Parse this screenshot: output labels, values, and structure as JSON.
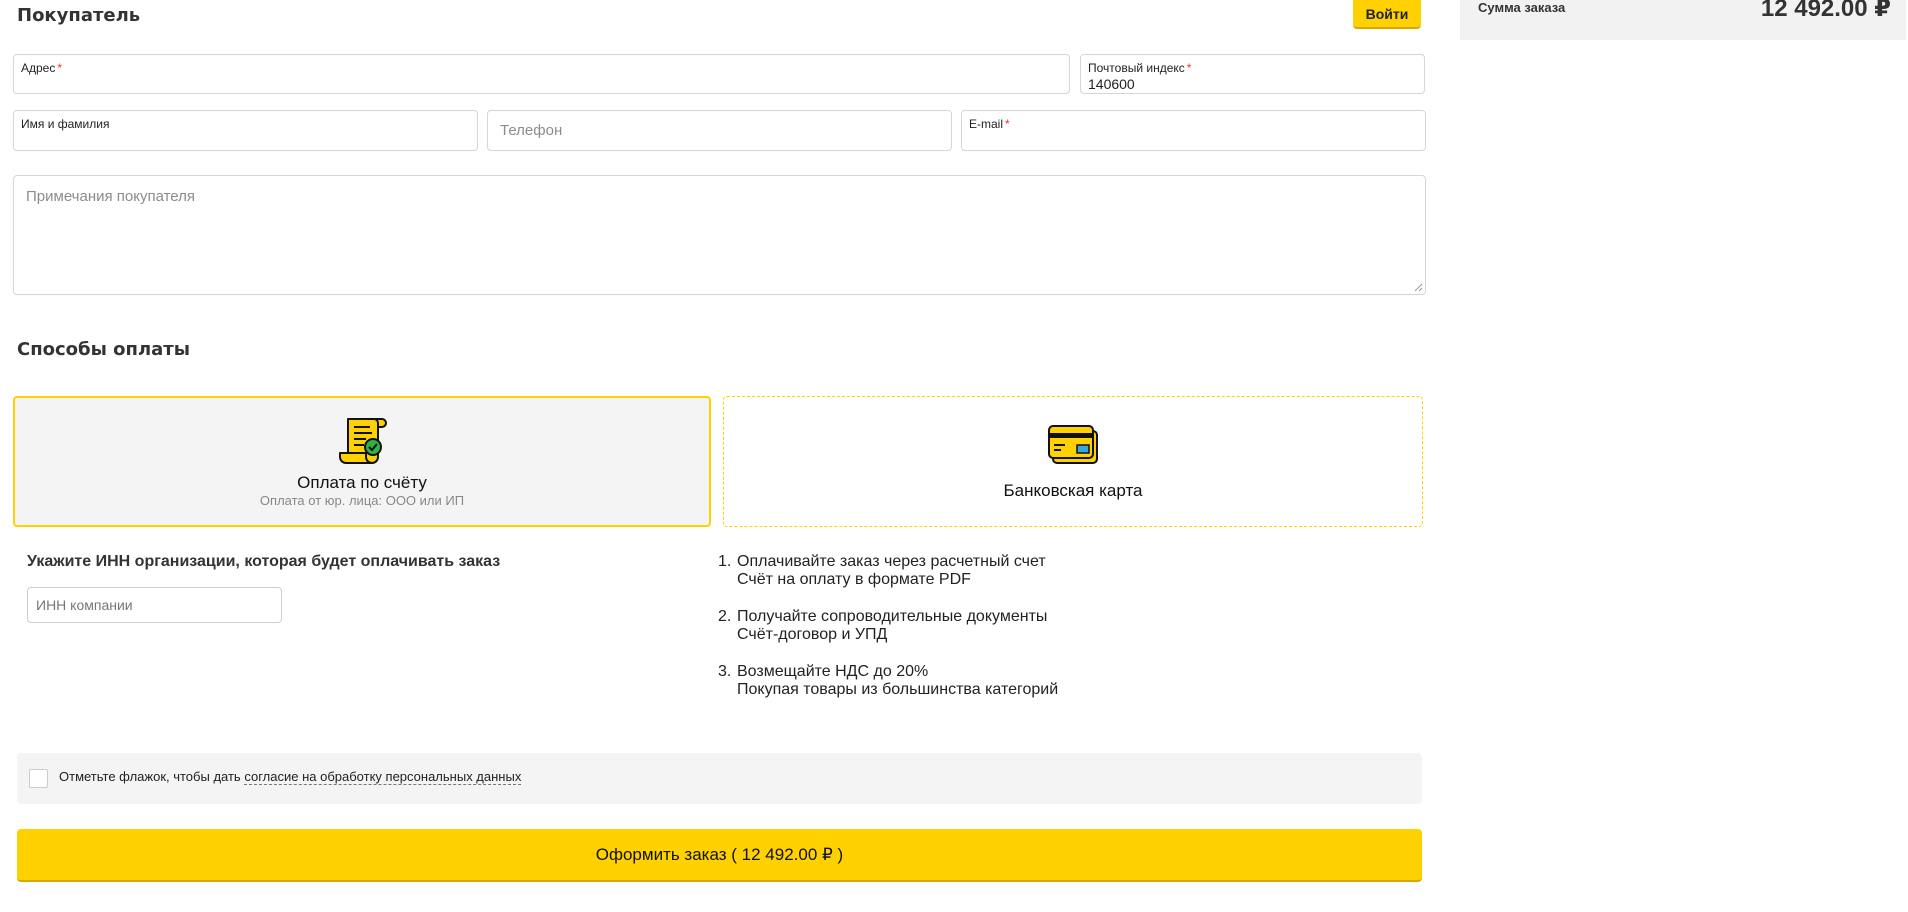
{
  "buyer": {
    "title": "Покупатель",
    "login_label": "Войти",
    "address": {
      "label": "Адрес",
      "required_mark": "*",
      "value": ""
    },
    "postal_code": {
      "label": "Почтовый индекс",
      "required_mark": "*",
      "value": "140600"
    },
    "full_name": {
      "label": "Имя и фамилия",
      "value": ""
    },
    "phone": {
      "placeholder": "Телефон"
    },
    "email": {
      "label": "E-mail",
      "required_mark": "*",
      "value": ""
    },
    "notes": {
      "placeholder": "Примечания покупателя"
    }
  },
  "summary": {
    "label": "Сумма заказа",
    "value": "12 492.00 ₽"
  },
  "payment": {
    "title": "Способы оплаты",
    "methods": [
      {
        "title": "Оплата по счёту",
        "subtitle": "Оплата от юр. лица: ООО или ИП",
        "icon": "invoice-scroll-icon",
        "selected": true
      },
      {
        "title": "Банковская карта",
        "icon": "bank-card-icon",
        "selected": false
      }
    ],
    "accent_color": "#ffd100"
  },
  "inn": {
    "title": "Укажите ИНН организации, которая будет оплачивать заказ",
    "placeholder": "ИНН компании"
  },
  "benefits": [
    {
      "num": "1.",
      "title": "Оплачивайте заказ через расчетный счет",
      "desc": "Счёт на оплату в формате PDF"
    },
    {
      "num": "2.",
      "title": "Получайте сопроводительные документы",
      "desc": "Счёт-договор и УПД"
    },
    {
      "num": "3.",
      "title": "Возмещайте НДС до 20%",
      "desc": "Покупая товары из большинства категорий"
    }
  ],
  "consent": {
    "text": "Отметьте флажок, чтобы дать",
    "link": "согласие на обработку персональных данных",
    "checked": false
  },
  "submit": {
    "label": "Оформить заказ ( 12 492.00 ₽ )"
  }
}
